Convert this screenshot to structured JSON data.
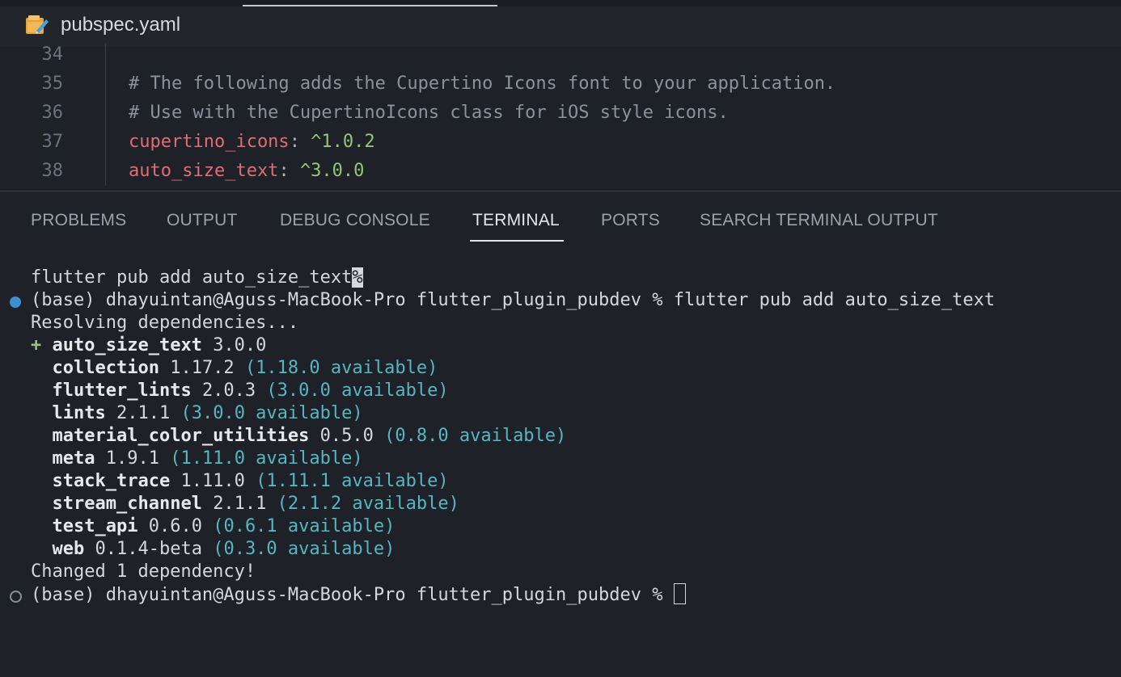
{
  "window": {
    "file_name": "pubspec.yaml",
    "file_icon": "yaml-file-icon"
  },
  "editor": {
    "lines": [
      {
        "number": "34",
        "parts": []
      },
      {
        "number": "35",
        "parts": [
          {
            "type": "comment",
            "text": "# The following adds the Cupertino Icons font to your application."
          }
        ]
      },
      {
        "number": "36",
        "parts": [
          {
            "type": "comment",
            "text": "# Use with the CupertinoIcons class for iOS style icons."
          }
        ]
      },
      {
        "number": "37",
        "parts": [
          {
            "type": "key",
            "text": "cupertino_icons"
          },
          {
            "type": "punct",
            "text": ": "
          },
          {
            "type": "val",
            "text": "^1.0.2"
          }
        ]
      },
      {
        "number": "38",
        "parts": [
          {
            "type": "key",
            "text": "auto_size_text"
          },
          {
            "type": "punct",
            "text": ": "
          },
          {
            "type": "val",
            "text": "^3.0.0"
          }
        ]
      }
    ]
  },
  "panel": {
    "tabs": [
      {
        "label": "PROBLEMS",
        "active": false
      },
      {
        "label": "OUTPUT",
        "active": false
      },
      {
        "label": "DEBUG CONSOLE",
        "active": false
      },
      {
        "label": "TERMINAL",
        "active": true
      },
      {
        "label": "PORTS",
        "active": false
      },
      {
        "label": "SEARCH TERMINAL OUTPUT",
        "active": false
      }
    ]
  },
  "terminal": {
    "prev_command": "flutter pub add auto_size_text",
    "prev_command_marker": "%",
    "prompt_1": "(base) dhayuintan@Aguss-MacBook-Pro flutter_plugin_pubdev % flutter pub add auto_size_text",
    "resolving": "Resolving dependencies...",
    "added": {
      "prefix": "+",
      "name": "auto_size_text",
      "version": "3.0.0"
    },
    "deps": [
      {
        "name": "collection",
        "version": "1.17.2",
        "available": "(1.18.0 available)"
      },
      {
        "name": "flutter_lints",
        "version": "2.0.3",
        "available": "(3.0.0 available)"
      },
      {
        "name": "lints",
        "version": "2.1.1",
        "available": "(3.0.0 available)"
      },
      {
        "name": "material_color_utilities",
        "version": "0.5.0",
        "available": "(0.8.0 available)"
      },
      {
        "name": "meta",
        "version": "1.9.1",
        "available": "(1.11.0 available)"
      },
      {
        "name": "stack_trace",
        "version": "1.11.0",
        "available": "(1.11.1 available)"
      },
      {
        "name": "stream_channel",
        "version": "2.1.1",
        "available": "(2.1.2 available)"
      },
      {
        "name": "test_api",
        "version": "0.6.0",
        "available": "(0.6.1 available)"
      },
      {
        "name": "web",
        "version": "0.1.4-beta",
        "available": "(0.3.0 available)"
      }
    ],
    "changed": "Changed 1 dependency!",
    "prompt_2": "(base) dhayuintan@Aguss-MacBook-Pro flutter_plugin_pubdev % "
  }
}
